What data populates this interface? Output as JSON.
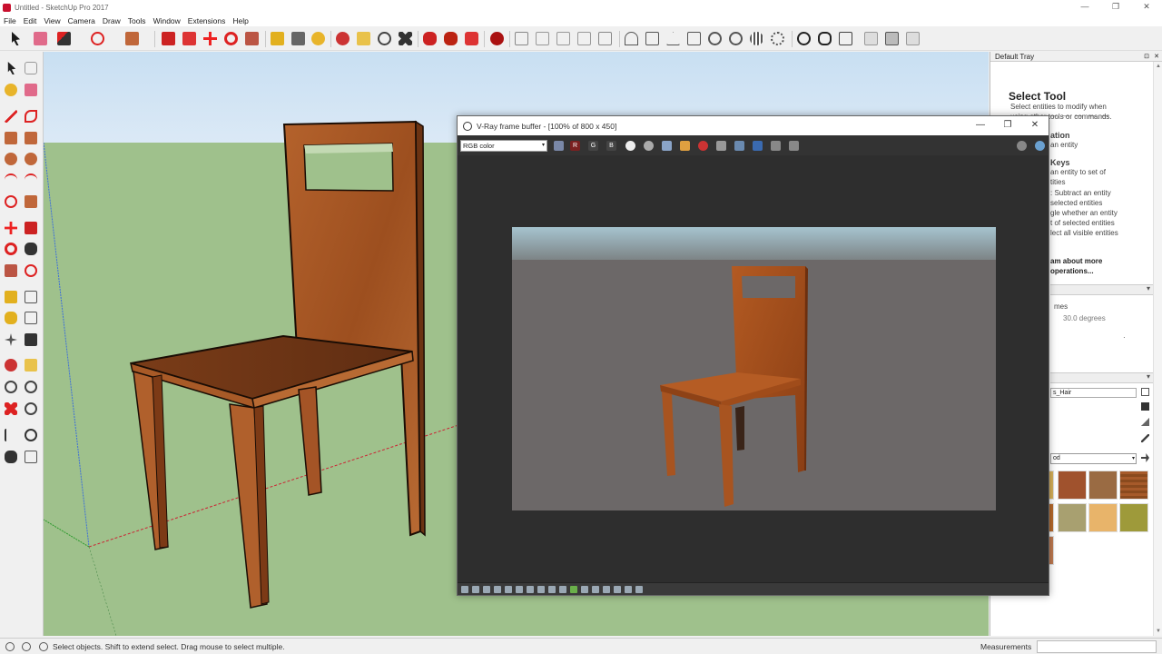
{
  "window": {
    "title": "Untitled - SketchUp Pro 2017",
    "controls": {
      "minimize": "—",
      "maximize": "❐",
      "close": "✕"
    }
  },
  "menu": [
    "File",
    "Edit",
    "View",
    "Camera",
    "Draw",
    "Tools",
    "Window",
    "Extensions",
    "Help"
  ],
  "colors": {
    "accent": "#c8102e",
    "ground": "#9fc18c",
    "sky": "#c8dff2",
    "vray_bg": "#2e2e2e",
    "wood": "#a4521f"
  },
  "tray": {
    "title": "Default Tray",
    "pin": "⊡",
    "close": "✕",
    "dots": "— — — — —",
    "select_tool": {
      "heading": "Select Tool",
      "lines": [
        "Select entities to modify when",
        "using other tools or commands."
      ],
      "op_heading": "ation",
      "op_line": "an entity",
      "keys_heading": "Keys",
      "key_lines": [
        "an entity to set of",
        "tities",
        ": Subtract an entity",
        "selected entities",
        "gle whether an entity",
        "t of selected entities",
        "lect all visible entities"
      ],
      "learn_more_1": "am about more",
      "learn_more_2": "operations..."
    },
    "entity_info": {
      "label": "mes",
      "value": "30.0 degrees",
      "dot": "·"
    },
    "materials": {
      "name_value": "s_Hair",
      "category": "od",
      "arrow": "▾"
    },
    "section_arrow": "▾",
    "scroll_up": "▲",
    "scroll_down": "▼"
  },
  "status": {
    "message": "Select objects. Shift to extend select. Drag mouse to select multiple.",
    "measurements": "Measurements"
  },
  "vray": {
    "title": "V-Ray frame buffer - [100% of 800 x 450]",
    "channel": "RGB color",
    "channel_arrow": "▾",
    "btn_r": "R",
    "btn_g": "G",
    "btn_b": "B"
  }
}
